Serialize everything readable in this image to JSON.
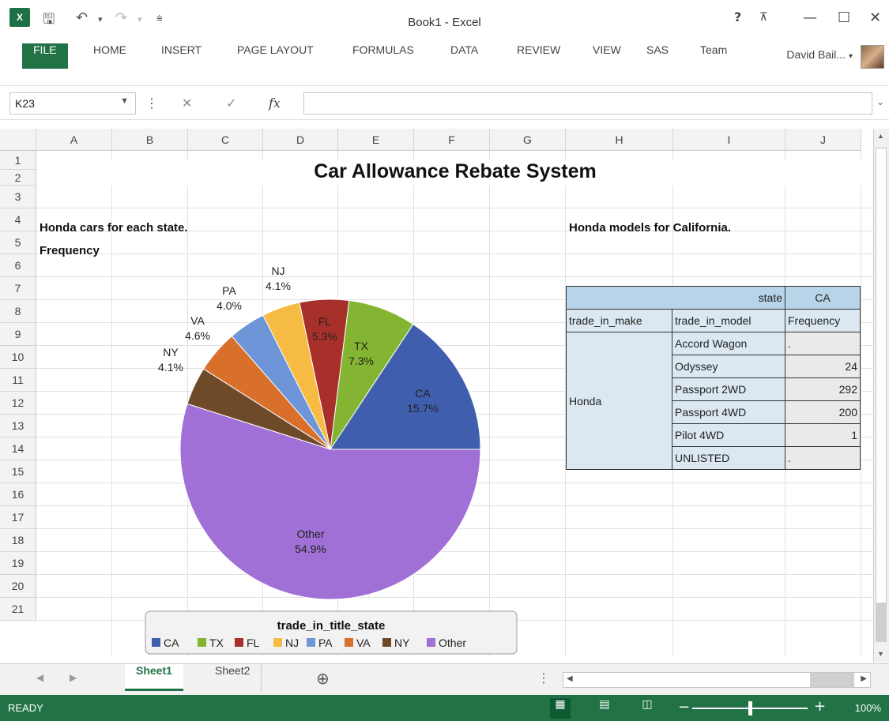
{
  "window": {
    "title": "Book1 - Excel",
    "user": "David Bail...",
    "help": "?",
    "minimize": "—",
    "maximize": "☐",
    "close": "✕"
  },
  "ribbon": {
    "tabs": [
      "FILE",
      "HOME",
      "INSERT",
      "PAGE LAYOUT",
      "FORMULAS",
      "DATA",
      "REVIEW",
      "VIEW",
      "SAS",
      "Team"
    ]
  },
  "formula_bar": {
    "name_box": "K23",
    "formula": "",
    "cancel_icon": "✕",
    "enter_icon": "✓",
    "fx_icon": "fx"
  },
  "grid": {
    "columns": [
      "A",
      "B",
      "C",
      "D",
      "E",
      "F",
      "G",
      "H",
      "I",
      "J"
    ],
    "rows": [
      "1",
      "2",
      "3",
      "4",
      "5",
      "6",
      "7",
      "8",
      "9",
      "10",
      "11",
      "12",
      "13",
      "14",
      "15",
      "16",
      "17",
      "18",
      "19",
      "20",
      "21"
    ],
    "title": "Car Allowance Rebate System",
    "a3": "Honda cars for each state.",
    "a4": "Frequency",
    "h3": "Honda models for California."
  },
  "pivot": {
    "state_label": "state",
    "state_value": "CA",
    "col_make": "trade_in_make",
    "col_model": "trade_in_model",
    "col_freq": "Frequency",
    "make": "Honda",
    "rows": [
      {
        "model": "Accord Wagon",
        "freq": "."
      },
      {
        "model": "Odyssey",
        "freq": "24"
      },
      {
        "model": "Passport 2WD",
        "freq": "292"
      },
      {
        "model": "Passport 4WD",
        "freq": "200"
      },
      {
        "model": "Pilot 4WD",
        "freq": "1"
      },
      {
        "model": "UNLISTED",
        "freq": "."
      }
    ]
  },
  "chart_data": {
    "type": "pie",
    "legend_title": "trade_in_title_state",
    "legend_placement": "bottom",
    "slices": [
      {
        "label": "CA",
        "value": 15.7,
        "display": "15.7%",
        "color": "#3f5fae"
      },
      {
        "label": "TX",
        "value": 7.3,
        "display": "7.3%",
        "color": "#84b532"
      },
      {
        "label": "FL",
        "value": 5.3,
        "display": "5.3%",
        "color": "#a8302a"
      },
      {
        "label": "NJ",
        "value": 4.1,
        "display": "4.1%",
        "color": "#f6bb43"
      },
      {
        "label": "PA",
        "value": 4.0,
        "display": "4.0%",
        "color": "#6f95d9"
      },
      {
        "label": "VA",
        "value": 4.6,
        "display": "4.6%",
        "color": "#d8702c"
      },
      {
        "label": "NY",
        "value": 4.1,
        "display": "4.1%",
        "color": "#6e4a28"
      },
      {
        "label": "Other",
        "value": 54.9,
        "display": "54.9%",
        "color": "#a070d6"
      }
    ]
  },
  "sheets": {
    "tabs": [
      "Sheet1",
      "Sheet2"
    ],
    "active": "Sheet1"
  },
  "status": {
    "text": "READY",
    "zoom": "100%",
    "zoom_level": 1.0
  }
}
